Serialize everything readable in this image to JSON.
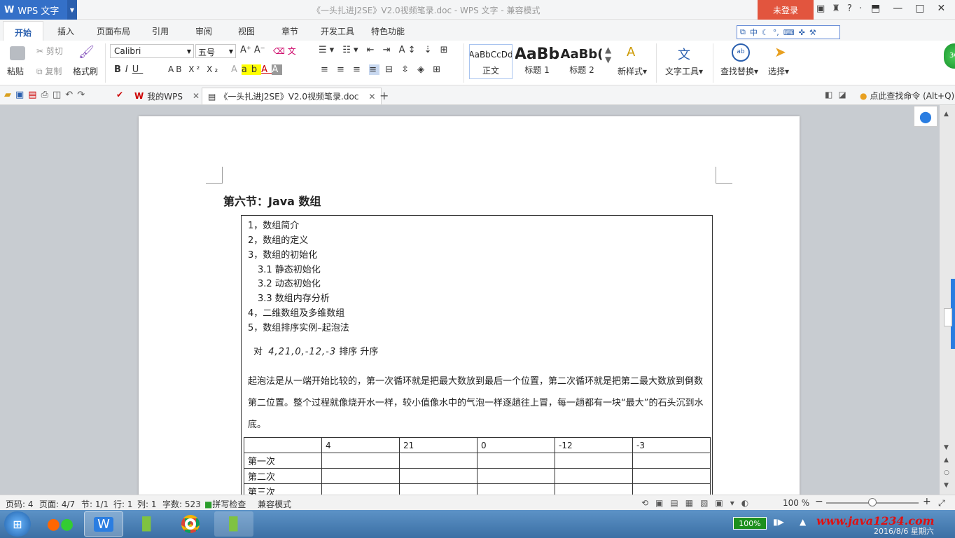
{
  "app": {
    "name": "WPS 文字",
    "title": "《一头扎进J2SE》V2.0视频笔录.doc - WPS 文字 - 兼容模式",
    "login": "未登录"
  },
  "menus": [
    "开始",
    "插入",
    "页面布局",
    "引用",
    "审阅",
    "视图",
    "章节",
    "开发工具",
    "特色功能"
  ],
  "ime": "中",
  "ribbon": {
    "paste": "粘贴",
    "cut": "剪切",
    "copy": "复制",
    "format_painter": "格式刷",
    "font": "Calibri",
    "size": "五号",
    "styles": [
      {
        "preview": "AaBbCcDd",
        "label": "正文"
      },
      {
        "preview": "AaBb",
        "label": "标题 1"
      },
      {
        "preview": "AaBb(",
        "label": "标题 2"
      }
    ],
    "new_style": "新样式",
    "text_tools": "文字工具",
    "find_replace": "查找替换",
    "select": "选择"
  },
  "tabs": {
    "mywps": "我的WPS",
    "doc": "《一头扎进J2SE》V2.0视频笔录.doc",
    "command_search": "点此查找命令 (Alt+Q)"
  },
  "doc": {
    "heading": "第六节：Java 数组",
    "toc": [
      {
        "text": "1，数组简介",
        "indent": false
      },
      {
        "text": "2，数组的定义",
        "indent": false
      },
      {
        "text": "3，数组的初始化",
        "indent": false
      },
      {
        "text": "3.1  静态初始化",
        "indent": true
      },
      {
        "text": "3.2  动态初始化",
        "indent": true
      },
      {
        "text": "3.3  数组内存分析",
        "indent": true
      },
      {
        "text": "4，二维数组及多维数组",
        "indent": false
      },
      {
        "text": "5，数组排序实例–起泡法",
        "indent": false
      }
    ],
    "sort_prefix": "对",
    "sort_values": "4,21,0,-12,-3",
    "sort_suffix": "排序 升序",
    "paragraph": "起泡法是从一端开始比较的，第一次循环就是把最大数放到最后一个位置，第二次循环就是把第二最大数放到倒数第二位置。整个过程就像烧开水一样，较小值像水中的气泡一样逐趟往上冒，每一趟都有一块“最大”的石头沉到水底。",
    "table_header": [
      "",
      "4",
      "21",
      "0",
      "-12",
      "-3"
    ],
    "table_rows": [
      "第一次",
      "第二次",
      "第三次"
    ]
  },
  "status": {
    "page_num": "页码: 4",
    "pages": "页面: 4/7",
    "section": "节: 1/1",
    "row": "行: 1",
    "col": "列: 1",
    "words": "字数: 523",
    "spell": "拼写检查",
    "compat": "兼容模式",
    "zoom": "100 %",
    "zoom_level": 0.5
  },
  "taskbar": {
    "battery": "100%",
    "watermark": "www.java1234.com",
    "date": "2016/8/6 星期六"
  }
}
